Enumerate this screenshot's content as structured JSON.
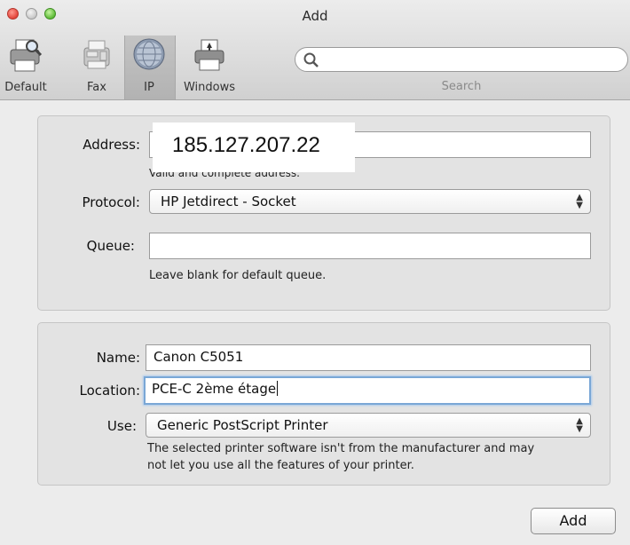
{
  "window": {
    "title": "Add"
  },
  "toolbar": {
    "items": [
      {
        "label": "Default",
        "icon": "printer-default-icon"
      },
      {
        "label": "Fax",
        "icon": "fax-icon"
      },
      {
        "label": "IP",
        "icon": "globe-icon",
        "selected": true
      },
      {
        "label": "Windows",
        "icon": "windows-printer-icon"
      }
    ],
    "search": {
      "placeholder": "",
      "label": "Search"
    }
  },
  "network": {
    "address_label": "Address:",
    "address_value": "185.127.207.22",
    "address_help": "Valid and complete address.",
    "protocol_label": "Protocol:",
    "protocol_value": "HP Jetdirect - Socket",
    "queue_label": "Queue:",
    "queue_value": "",
    "queue_help": "Leave blank for default queue."
  },
  "printer": {
    "name_label": "Name:",
    "name_value": "Canon C5051",
    "location_label": "Location:",
    "location_value": "PCE-C 2ème étage",
    "use_label": "Use:",
    "use_value": "Generic PostScript Printer",
    "use_help_line1": "The selected printer software isn't from the manufacturer and may",
    "use_help_line2": "not let you use all the features of your printer."
  },
  "actions": {
    "add_label": "Add"
  },
  "colors": {
    "focus_ring": "#7aa7d6",
    "close": "#e3443a",
    "zoom": "#5dbb36"
  }
}
